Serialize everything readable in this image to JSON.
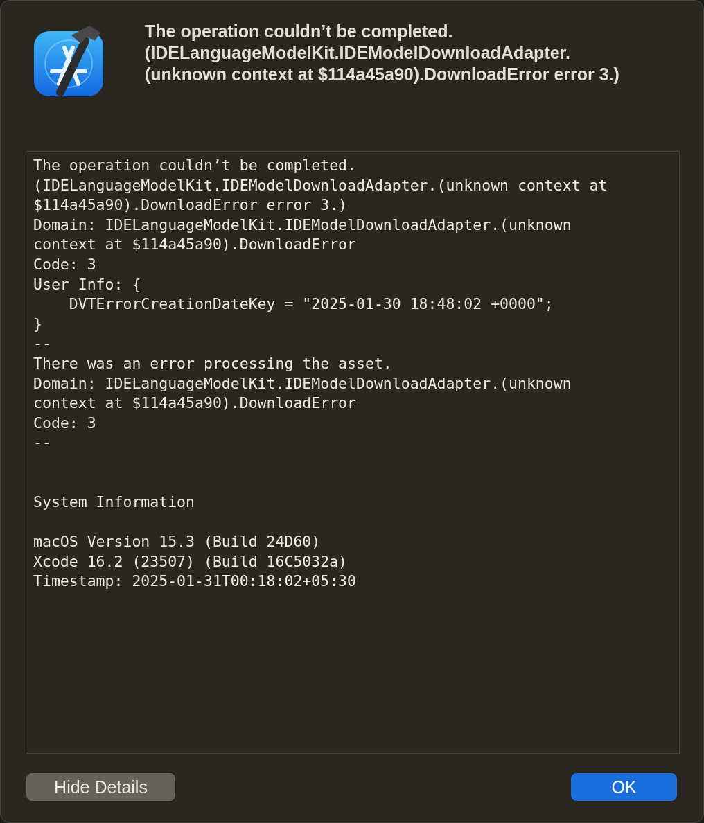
{
  "alert": {
    "message": "The operation couldn’t be completed. (IDELanguageModelKit.IDEModelDownloadAdapter.(unknown context at $114a45a90).DownloadError error 3.)",
    "details": "The operation couldn’t be completed.\n(IDELanguageModelKit.IDEModelDownloadAdapter.(unknown context at\n$114a45a90).DownloadError error 3.)\nDomain: IDELanguageModelKit.IDEModelDownloadAdapter.(unknown\ncontext at $114a45a90).DownloadError\nCode: 3\nUser Info: {\n    DVTErrorCreationDateKey = \"2025-01-30 18:48:02 +0000\";\n}\n--\nThere was an error processing the asset.\nDomain: IDELanguageModelKit.IDEModelDownloadAdapter.(unknown\ncontext at $114a45a90).DownloadError\nCode: 3\n--\n\n\nSystem Information\n\nmacOS Version 15.3 (Build 24D60)\nXcode 16.2 (23507) (Build 16C5032a)\nTimestamp: 2025-01-31T00:18:02+05:30",
    "buttons": [
      {
        "label": "Hide Details",
        "kind": "secondary"
      },
      {
        "label": "OK",
        "kind": "default"
      }
    ]
  }
}
